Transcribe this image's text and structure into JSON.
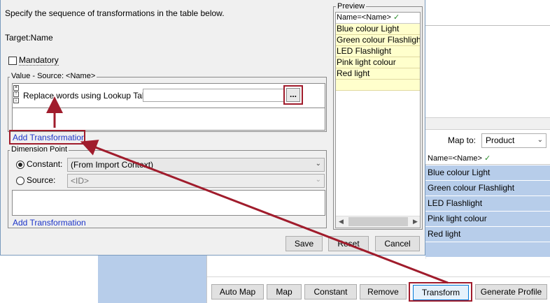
{
  "dialog": {
    "instruction": "Specify the sequence of transformations in the table below.",
    "target": "Target:Name",
    "mandatory_label": "Mandatory",
    "value_group_title": "Value - Source: <Name>",
    "replace_label": "Replace words using Lookup Table:",
    "lookup_value": "",
    "browse_label": "...",
    "add_transformation": "Add Transformation",
    "dimension_group_title": "Dimension Point",
    "constant_label": "Constant:",
    "constant_value": "(From Import Context)",
    "source_label": "Source:",
    "source_value": "<ID>",
    "add_transformation_2": "Add Transformation",
    "buttons": {
      "save": "Save",
      "reset": "Reset",
      "cancel": "Cancel"
    }
  },
  "preview": {
    "title": "Preview",
    "header": "Name=<Name>",
    "header_check": "✓",
    "rows": [
      "Blue colour Light",
      "Green colour Flashlight",
      "LED Flashlight",
      "Pink light colour",
      "Red light"
    ]
  },
  "background": {
    "map_to_label": "Map to:",
    "map_to_value": "Product",
    "grid_header": "Name=<Name>",
    "grid_header_check": "✓",
    "grid_rows": [
      "Blue colour Light",
      "Green colour Flashlight",
      "LED Flashlight",
      "Pink light colour",
      "Red light"
    ],
    "toolbar": {
      "auto_map": "Auto Map",
      "map": "Map",
      "constant": "Constant",
      "remove": "Remove",
      "transform": "Transform",
      "generate_profile": "Generate Profile"
    }
  },
  "colors": {
    "highlight": "#a01c2c",
    "link": "#1c34c8",
    "preview_row": "#ffffcc",
    "grid_row": "#b7cdea"
  }
}
